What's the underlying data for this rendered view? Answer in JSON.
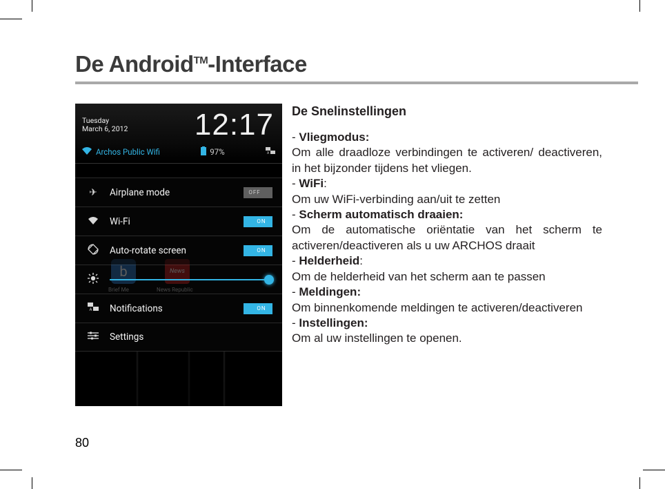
{
  "page_title_prefix": "De Android",
  "page_title_tm": "TM",
  "page_title_suffix": "-Interface",
  "page_number": "80",
  "screenshot": {
    "day": "Tuesday",
    "date": "March 6, 2012",
    "time": "12:17",
    "wifi_name": "Archos Public Wifi",
    "battery": "97%",
    "ghost_app1": "b",
    "ghost_app1_caption": "Brief Me",
    "ghost_app2": "News",
    "ghost_app2_caption": "News Republic",
    "rows": {
      "airplane": "Airplane mode",
      "wifi": "Wi-Fi",
      "autorotate": "Auto-rotate screen",
      "notifications": "Notifications",
      "settings": "Settings"
    },
    "toggle_off": "OFF",
    "toggle_on": "ON"
  },
  "section_title": "De Snelinstellingen",
  "items": [
    {
      "label": "Vliegmodus:",
      "desc": "Om alle draadloze verbindingen te activeren/ deactiveren, in het bijzonder tijdens het vliegen."
    },
    {
      "label": "WiFi",
      "suffix": ":",
      "desc": "Om uw WiFi-verbinding aan/uit te zetten"
    },
    {
      "label": "Scherm automatisch draaien:",
      "desc": "Om de automatische oriëntatie van het scherm te activeren/deactiveren als u uw ARCHOS draait"
    },
    {
      "label": "Helderheid",
      "suffix": ":",
      "desc": "Om de helderheid van het scherm aan te passen"
    },
    {
      "label": "Meldingen:",
      "desc": "Om binnenkomende meldingen te activeren/deactiveren"
    },
    {
      "label": "Instellingen:",
      "desc": "Om al uw instellingen te openen."
    }
  ]
}
